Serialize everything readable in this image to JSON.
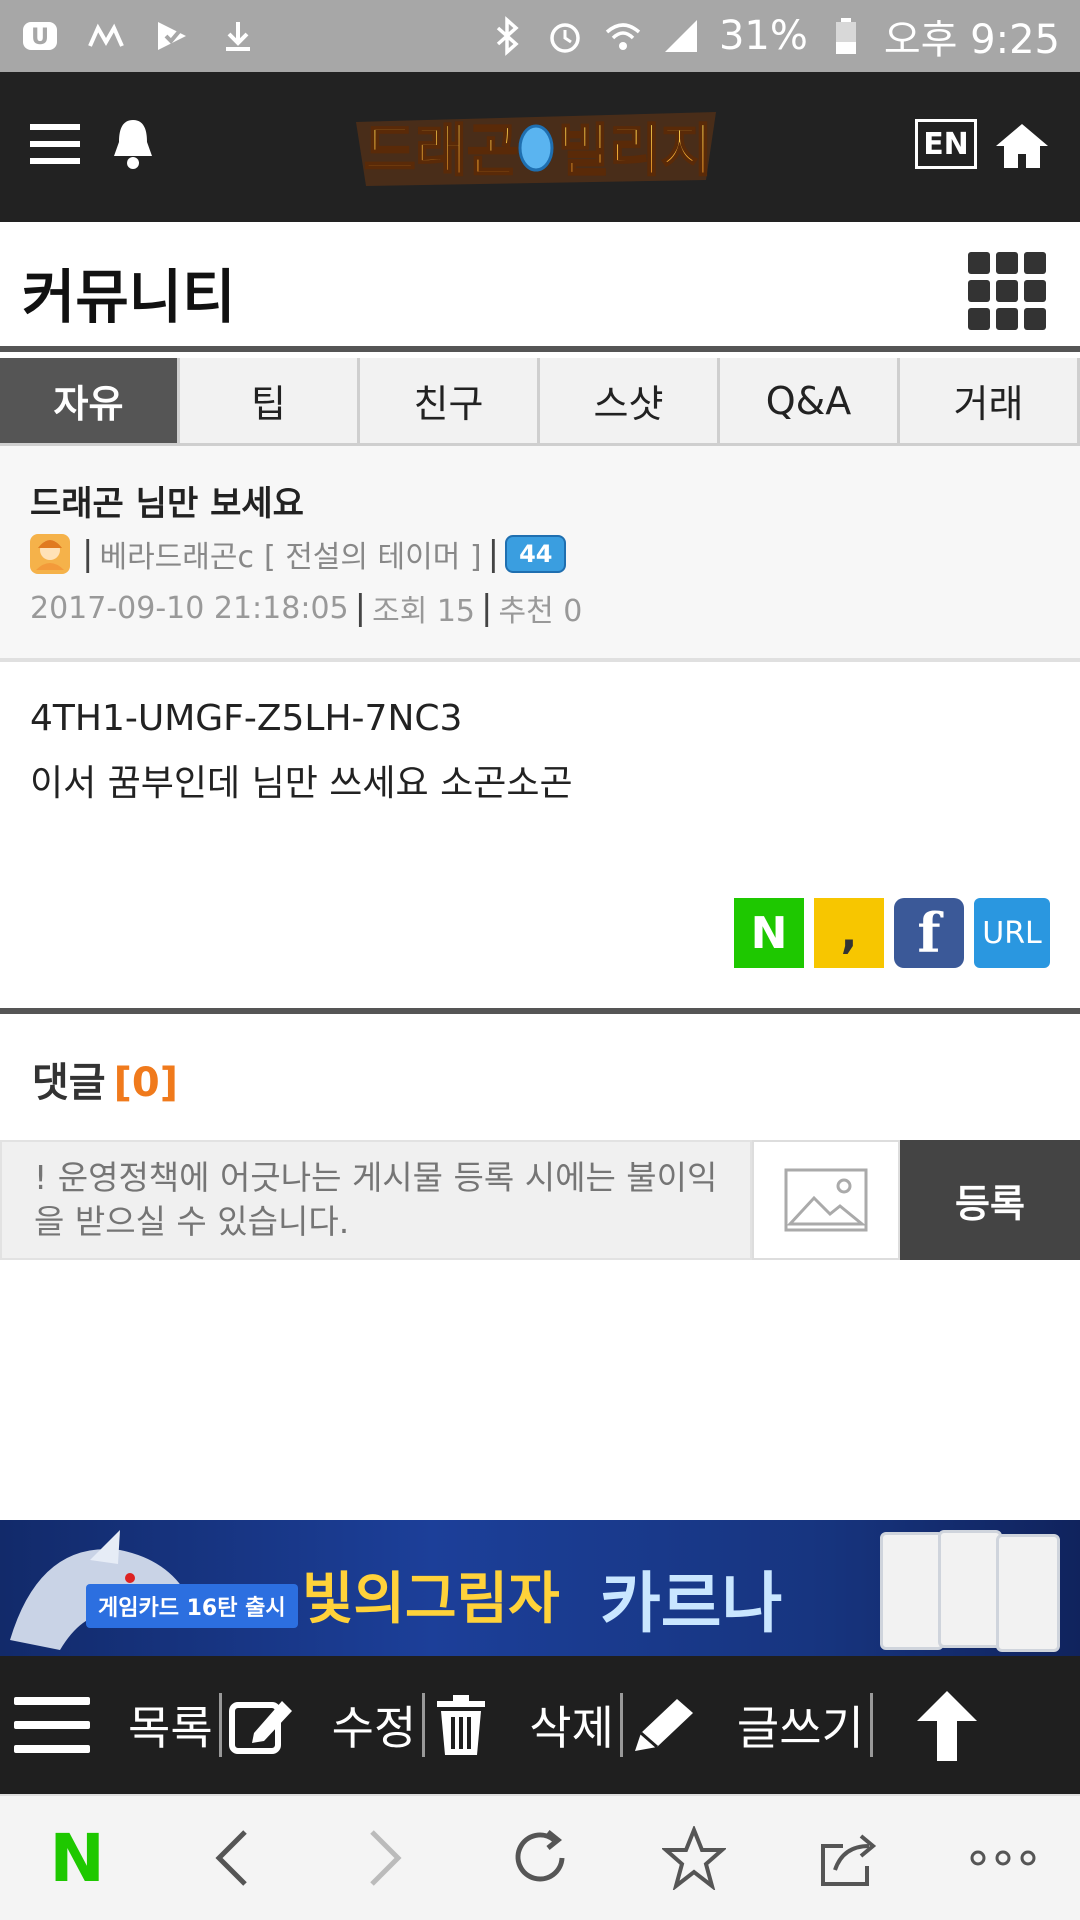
{
  "status_bar": {
    "battery": "31%",
    "time": "오후 9:25"
  },
  "header": {
    "logo_text": "드래곤빌리지",
    "lang_button": "EN"
  },
  "page": {
    "title": "커뮤니티"
  },
  "tabs": [
    {
      "label": "자유",
      "active": true
    },
    {
      "label": "팁",
      "active": false
    },
    {
      "label": "친구",
      "active": false
    },
    {
      "label": "스샷",
      "active": false
    },
    {
      "label": "Q&A",
      "active": false
    },
    {
      "label": "거래",
      "active": false
    }
  ],
  "post": {
    "title": "드래곤 님만 보세요",
    "author": "베라드래곤c",
    "author_title": "[ 전설의 테이머 ]",
    "level": "44",
    "datetime": "2017-09-10 21:18:05",
    "views": "조회 15",
    "likes": "추천 0",
    "body_line1": "4TH1-UMGF-Z5LH-7NC3",
    "body_line2": "이서 꿈부인데 님만 쓰세요 소곤소곤"
  },
  "share": {
    "naver": "N",
    "kakao": ",",
    "facebook": "f",
    "url": "URL"
  },
  "comments": {
    "label": "댓글",
    "count": "[0]",
    "placeholder": "! 운영정책에 어긋나는 게시물 등록 시에는 불이익을 받으실 수 있습니다.",
    "submit": "등록"
  },
  "banner": {
    "badge": "게임카드 16탄 출시",
    "title": "빛의그림자",
    "subtitle": "카르나"
  },
  "action_bar": {
    "list": "목록",
    "edit": "수정",
    "delete": "삭제",
    "write": "글쓰기"
  },
  "browser_bar": {
    "naver": "N"
  },
  "colors": {
    "accent_orange": "#f07a1c",
    "naver_green": "#1ec800",
    "header_bg": "#222222"
  }
}
